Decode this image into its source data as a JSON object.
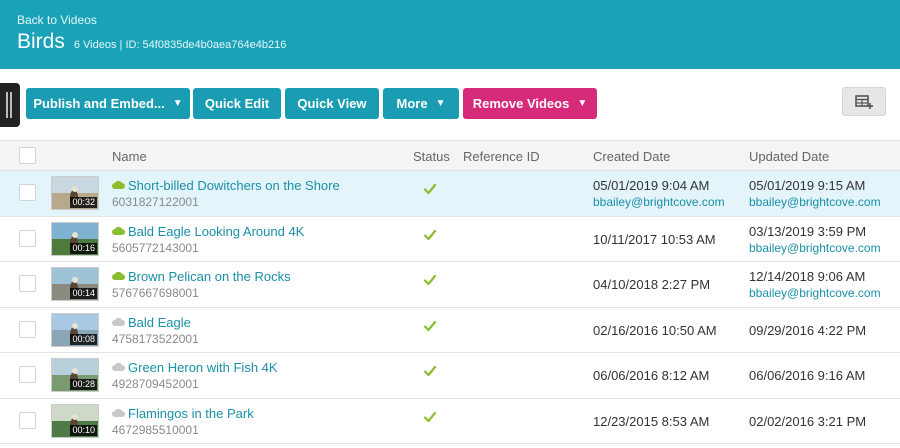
{
  "header": {
    "back_label": "Back to Videos",
    "title": "Birds",
    "subtitle": "6 Videos | ID: 54f0835de4b0aea764e4b216"
  },
  "toolbar": {
    "publish_label": "Publish and Embed...",
    "quick_edit_label": "Quick Edit",
    "quick_view_label": "Quick View",
    "more_label": "More",
    "remove_label": "Remove Videos",
    "caret": "▼"
  },
  "colors": {
    "header": "#1aa3b8",
    "button": "#1a9cb3",
    "remove": "#d62a7a",
    "link": "#1a8fa8",
    "check": "#8bbd2e"
  },
  "table": {
    "columns": {
      "name": "Name",
      "status": "Status",
      "reference": "Reference ID",
      "created": "Created Date",
      "updated": "Updated Date"
    },
    "rows": [
      {
        "duration": "00:32",
        "name": "Short-billed Dowitchers on the Shore",
        "id": "6031827122001",
        "cloud": "green",
        "created": "05/01/2019 9:04 AM",
        "created_by": "bbailey@brightcove.com",
        "updated": "05/01/2019 9:15 AM",
        "updated_by": "bbailey@brightcove.com",
        "selected": true
      },
      {
        "duration": "00:16",
        "name": "Bald Eagle Looking Around 4K",
        "id": "5605772143001",
        "cloud": "green",
        "created": "10/11/2017 10:53 AM",
        "created_by": "",
        "updated": "03/13/2019 3:59 PM",
        "updated_by": "bbailey@brightcove.com",
        "selected": false
      },
      {
        "duration": "00:14",
        "name": "Brown Pelican on the Rocks",
        "id": "5767667698001",
        "cloud": "green",
        "created": "04/10/2018 2:27 PM",
        "created_by": "",
        "updated": "12/14/2018 9:06 AM",
        "updated_by": "bbailey@brightcove.com",
        "selected": false
      },
      {
        "duration": "00:08",
        "name": "Bald Eagle",
        "id": "4758173522001",
        "cloud": "gray",
        "created": "02/16/2016 10:50 AM",
        "created_by": "",
        "updated": "09/29/2016 4:22 PM",
        "updated_by": "",
        "selected": false
      },
      {
        "duration": "00:28",
        "name": "Green Heron with Fish 4K",
        "id": "4928709452001",
        "cloud": "gray",
        "created": "06/06/2016 8:12 AM",
        "created_by": "",
        "updated": "06/06/2016 9:16 AM",
        "updated_by": "",
        "selected": false
      },
      {
        "duration": "00:10",
        "name": "Flamingos in the Park",
        "id": "4672985510001",
        "cloud": "gray",
        "created": "12/23/2015 8:53 AM",
        "created_by": "",
        "updated": "02/02/2016 3:21 PM",
        "updated_by": "",
        "selected": false
      }
    ]
  }
}
